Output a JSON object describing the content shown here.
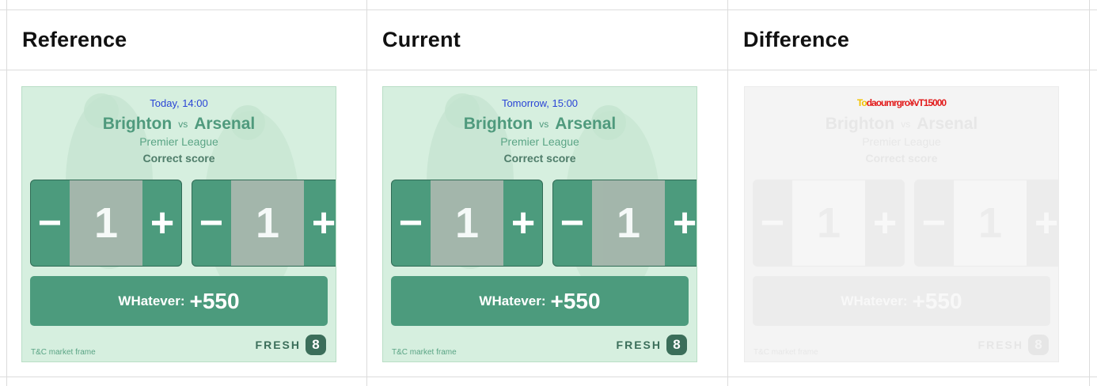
{
  "headers": [
    "Reference",
    "Current",
    "Difference"
  ],
  "panels": {
    "reference": {
      "date": "Today, 14:00",
      "home": "Brighton",
      "vs": "vs",
      "away": "Arsenal",
      "league": "Premier League",
      "market": "Correct score",
      "score_home": "1",
      "score_away": "1",
      "minus": "−",
      "plus": "+",
      "cta_label": "WHatever:",
      "cta_odds": "+550",
      "tc": "T&C market frame",
      "brand": "FRESH",
      "brand_mark": "8"
    },
    "current": {
      "date": "Tomorrow, 15:00",
      "home": "Brighton",
      "vs": "vs",
      "away": "Arsenal",
      "league": "Premier League",
      "market": "Correct score",
      "score_home": "1",
      "score_away": "1",
      "minus": "−",
      "plus": "+",
      "cta_label": "WHatever:",
      "cta_odds": "+550",
      "tc": "T&C market frame",
      "brand": "FRESH",
      "brand_mark": "8"
    },
    "difference": {
      "date_prefix": "To",
      "date_overlap": "daoumrgro¥vT15000",
      "home": "Brighton",
      "vs": "vs",
      "away": "Arsenal",
      "league": "Premier League",
      "market": "Correct score",
      "score_home": "1",
      "score_away": "1",
      "minus": "−",
      "plus": "+",
      "cta_label": "WHatever:",
      "cta_odds": "+550",
      "tc": "T&C market frame",
      "brand": "FRESH",
      "brand_mark": "8"
    }
  },
  "colors": {
    "widget_bg": "#d6efdf",
    "accent": "#4c9b7d",
    "date_text": "#2a44d6",
    "diff_yellow": "#f2c200",
    "diff_red": "#e21b1b"
  },
  "icons": [
    "minus-icon",
    "plus-icon",
    "fresh8-logo-icon"
  ]
}
